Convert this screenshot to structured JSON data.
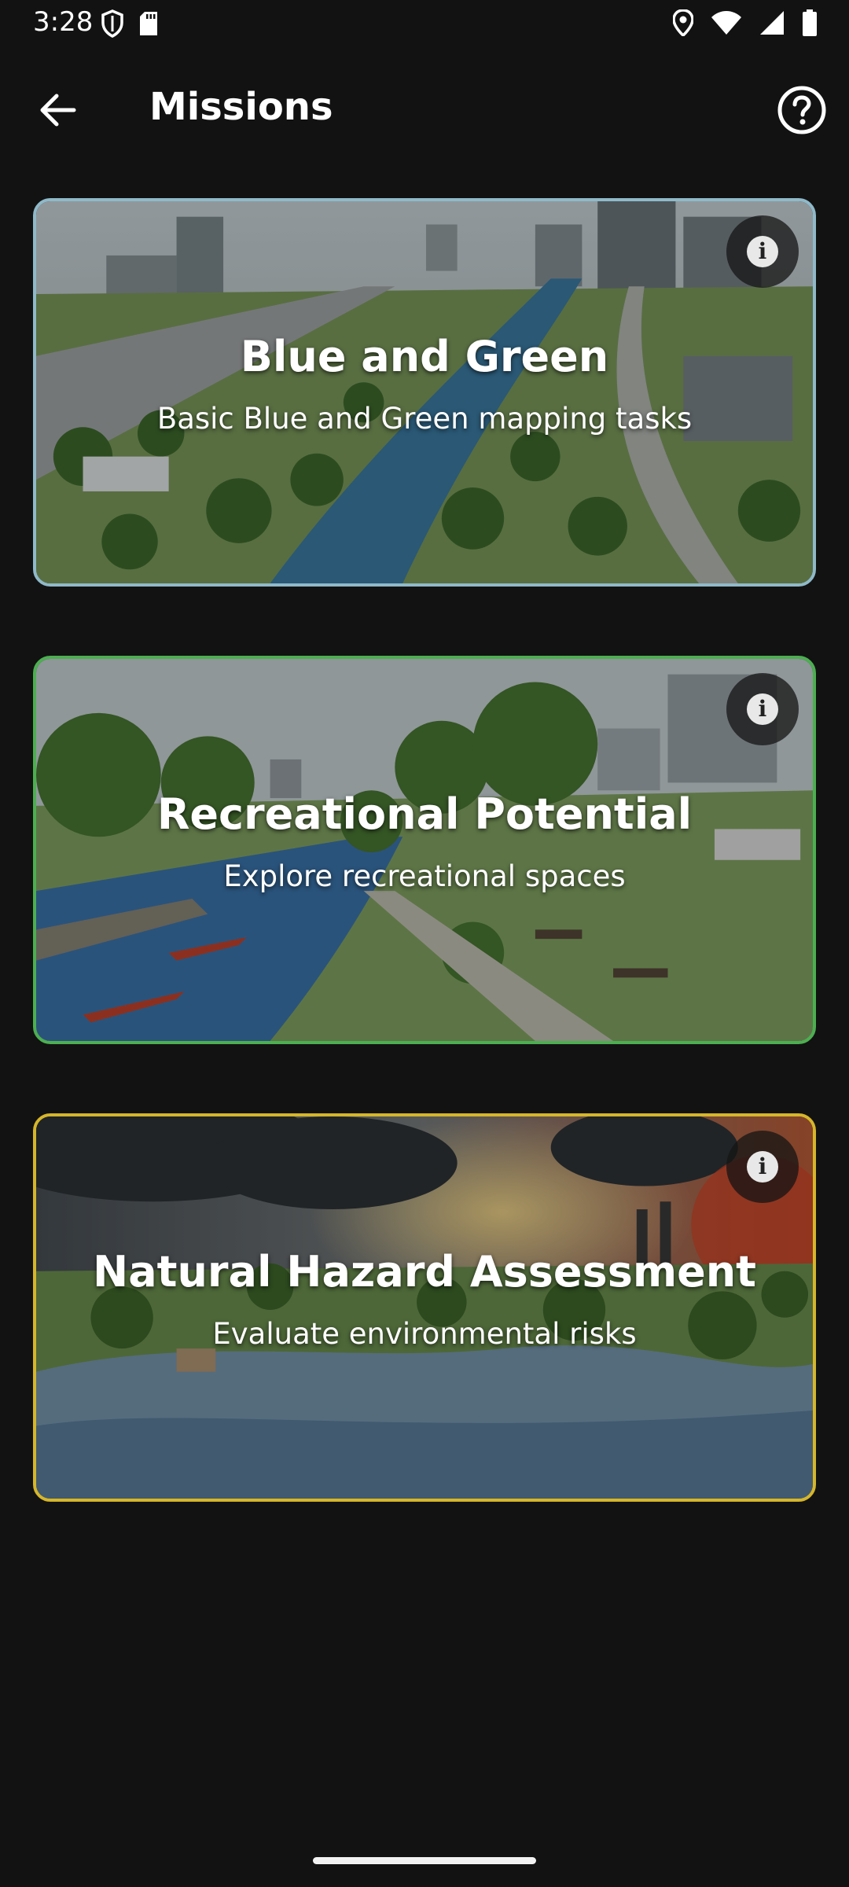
{
  "status_bar": {
    "time": "3:28",
    "left_icons": [
      "shield-icon",
      "sd-card-icon"
    ],
    "right_icons": [
      "location-icon",
      "wifi-icon",
      "signal-icon",
      "battery-icon"
    ]
  },
  "app_bar": {
    "title": "Missions",
    "back_icon": "arrow-back-icon",
    "help_icon": "help-circle-icon"
  },
  "missions": [
    {
      "title": "Blue and Green",
      "subtitle": "Basic Blue and Green mapping tasks",
      "border_color": "#8fb9c9",
      "info_icon": "info-icon"
    },
    {
      "title": "Recreational Potential",
      "subtitle": "Explore recreational spaces",
      "border_color": "#4caf50",
      "info_icon": "info-icon"
    },
    {
      "title": "Natural Hazard Assessment",
      "subtitle": "Evaluate environmental risks",
      "border_color": "#d6b62a",
      "info_icon": "info-icon"
    }
  ],
  "colors": {
    "background": "#121212",
    "text": "#ffffff"
  }
}
